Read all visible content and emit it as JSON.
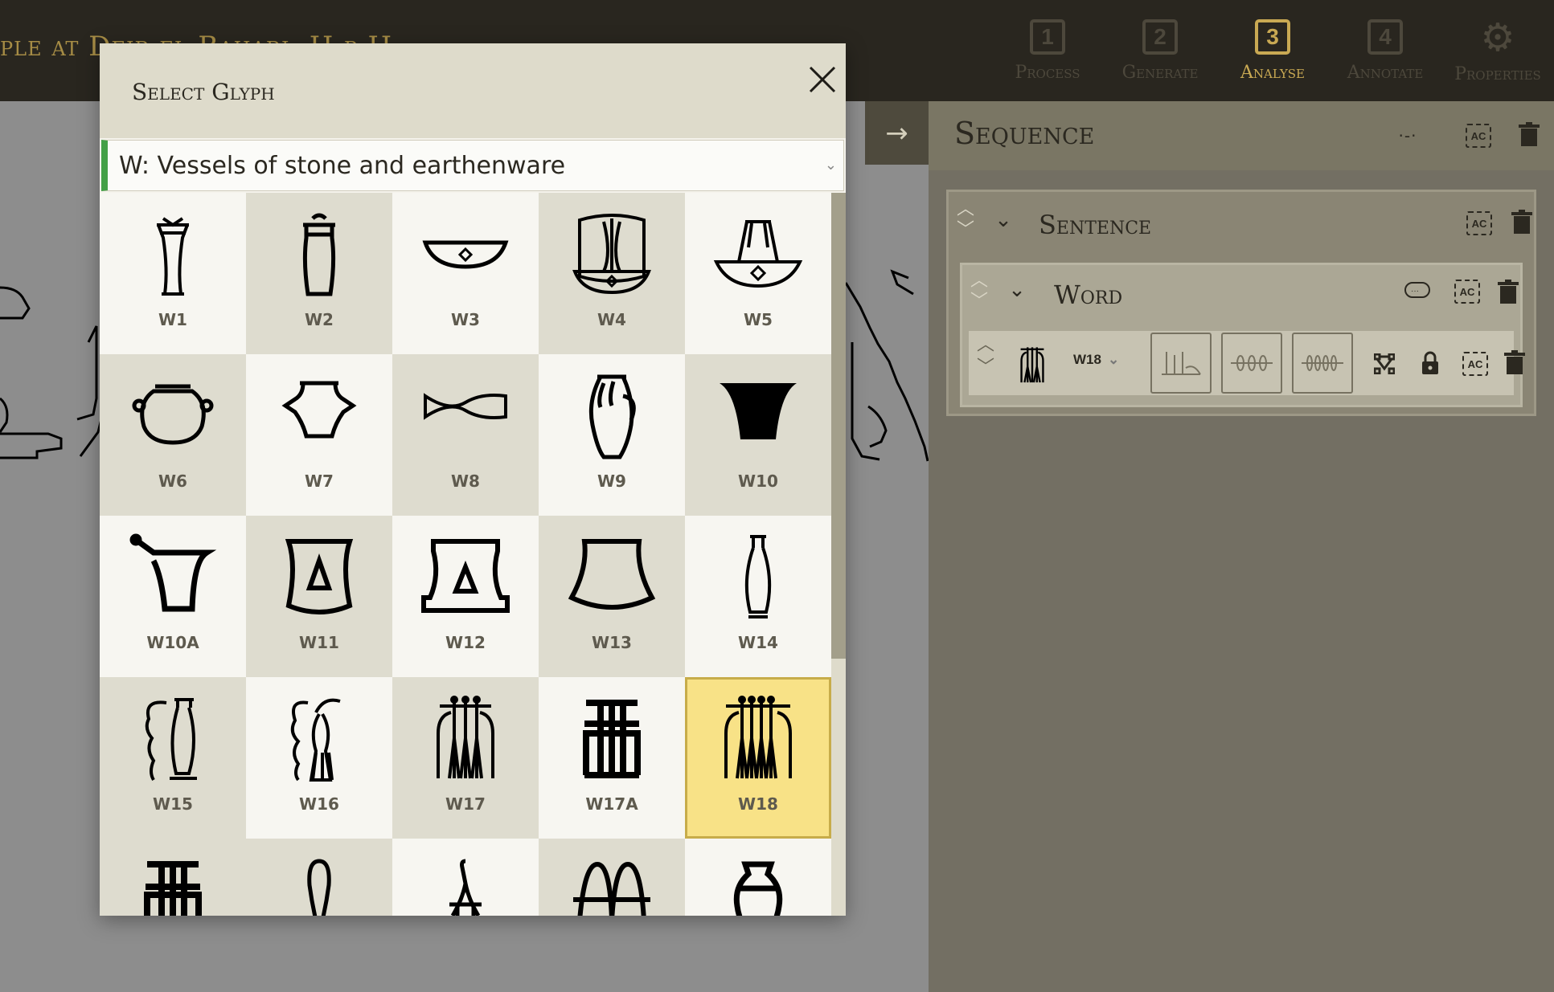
{
  "header": {
    "doc_title": "ple at Deir el-Bahari: H-p-H",
    "steps": [
      {
        "num": "1",
        "label": "Process"
      },
      {
        "num": "2",
        "label": "Generate"
      },
      {
        "num": "3",
        "label": "Analyse"
      },
      {
        "num": "4",
        "label": "Annotate"
      },
      {
        "label": "Properties",
        "icon": "gear-icon"
      }
    ],
    "active_step": "Analyse"
  },
  "sequence": {
    "title": "Sequence",
    "ac_label": "AC",
    "sentence_label": "Sentence",
    "word_label": "Word",
    "glyph": {
      "code": "W18"
    }
  },
  "modal": {
    "title": "Select Glyph",
    "category": "W: Vessels of stone and earthenware",
    "glyphs": [
      {
        "code": "W1"
      },
      {
        "code": "W2"
      },
      {
        "code": "W3"
      },
      {
        "code": "W4"
      },
      {
        "code": "W5"
      },
      {
        "code": "W6"
      },
      {
        "code": "W7"
      },
      {
        "code": "W8"
      },
      {
        "code": "W9"
      },
      {
        "code": "W10"
      },
      {
        "code": "W10A"
      },
      {
        "code": "W11"
      },
      {
        "code": "W12"
      },
      {
        "code": "W13"
      },
      {
        "code": "W14"
      },
      {
        "code": "W15"
      },
      {
        "code": "W16"
      },
      {
        "code": "W17"
      },
      {
        "code": "W17A"
      },
      {
        "code": "W18"
      },
      {
        "code": ""
      },
      {
        "code": ""
      },
      {
        "code": ""
      },
      {
        "code": ""
      },
      {
        "code": ""
      }
    ],
    "selected": "W18"
  },
  "colors": {
    "accent": "#c9a953",
    "topbar": "#29261f",
    "selected_cell": "#f8e287",
    "category_marker": "#43a047"
  }
}
